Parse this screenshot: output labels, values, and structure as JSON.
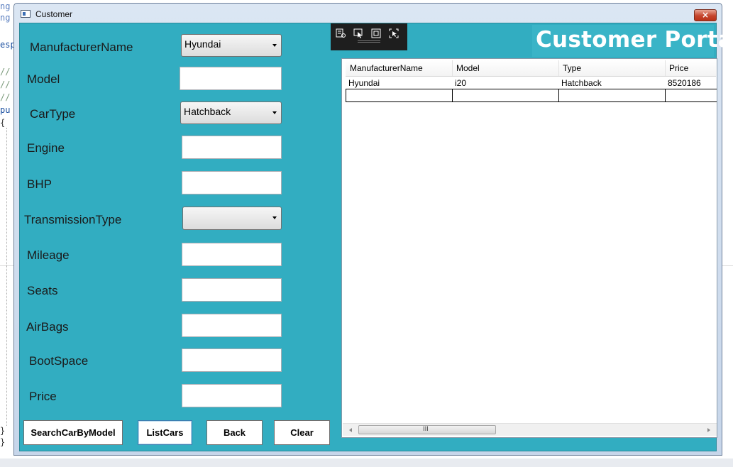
{
  "ide_fragments": {
    "line1": "ng",
    "line2": "ng",
    "line3": "esp",
    "line4": "//",
    "line5": "//",
    "line6": "//",
    "line7": "pu",
    "line8": "{",
    "line9": "}",
    "line10": "}"
  },
  "window": {
    "title": "Customer",
    "close_glyph": "×"
  },
  "form": {
    "manufacturer_label": "ManufacturerName",
    "manufacturer_value": "Hyundai",
    "model_label": "Model",
    "model_value": "",
    "cartype_label": "CarType",
    "cartype_value": "Hatchback",
    "engine_label": "Engine",
    "engine_value": "",
    "bhp_label": "BHP",
    "bhp_value": "",
    "transmission_label": "TransmissionType",
    "transmission_value": "",
    "mileage_label": "Mileage",
    "mileage_value": "",
    "seats_label": "Seats",
    "seats_value": "",
    "airbags_label": "AirBags",
    "airbags_value": "",
    "bootspace_label": "BootSpace",
    "bootspace_value": "",
    "price_label": "Price",
    "price_value": ""
  },
  "buttons": {
    "search": "SearchCarByModel",
    "list": "ListCars",
    "back": "Back",
    "clear": "Clear"
  },
  "header": {
    "portal_title": "Customer Portal"
  },
  "devtools": {
    "icons": [
      "live-visual-tree-icon",
      "select-element-icon",
      "display-layout-adorners-icon",
      "track-focus-icon"
    ]
  },
  "grid": {
    "columns": [
      "ManufacturerName",
      "Model",
      "Type",
      "Price"
    ],
    "rows": [
      [
        "Hyundai",
        "i20",
        "Hatchback",
        "8520186"
      ]
    ],
    "scroll_grip": "III"
  },
  "colors": {
    "client_bg": "#32adc1",
    "portal_bg": "#3ab4c7",
    "close_button": "#c5442c"
  }
}
